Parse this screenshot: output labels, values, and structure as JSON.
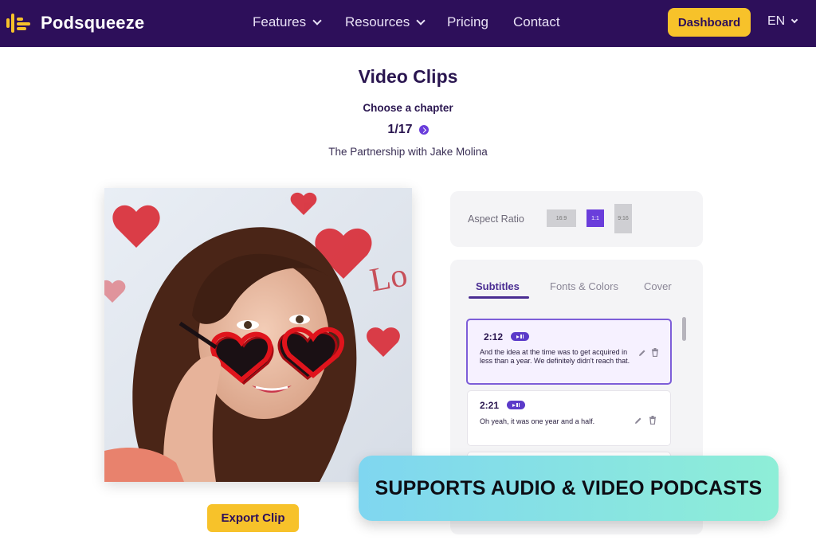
{
  "nav": {
    "brand": "Podsqueeze",
    "items": [
      {
        "label": "Features",
        "dropdown": true
      },
      {
        "label": "Resources",
        "dropdown": true
      },
      {
        "label": "Pricing",
        "dropdown": false
      },
      {
        "label": "Contact",
        "dropdown": false
      }
    ],
    "dashboard_label": "Dashboard",
    "language": "EN"
  },
  "page": {
    "title": "Video Clips",
    "chapter_prompt": "Choose a chapter",
    "chapter_counter": "1/17",
    "chapter_name": "The Partnership with Jake Molina"
  },
  "export_label": "Export Clip",
  "aspect": {
    "label": "Aspect Ratio",
    "options": [
      "16:9",
      "1:1",
      "9:16"
    ],
    "selected": "1:1"
  },
  "tabs": [
    "Subtitles",
    "Fonts & Colors",
    "Cover"
  ],
  "active_tab": "Subtitles",
  "subtitles": [
    {
      "time": "2:12",
      "text": "And the idea at the time was to get acquired in less than a year. We definitely didn't reach that.",
      "selected": true
    },
    {
      "time": "2:21",
      "text": "Oh yeah, it was one year and a half.",
      "selected": false
    }
  ],
  "banner": "SUPPORTS AUDIO & VIDEO PODCASTS",
  "colors": {
    "nav_bg": "#2d0f5a",
    "accent_yellow": "#f7c22a",
    "accent_purple": "#6a3ddb",
    "banner_start": "#7fd6f0",
    "banner_end": "#8eeed7"
  }
}
